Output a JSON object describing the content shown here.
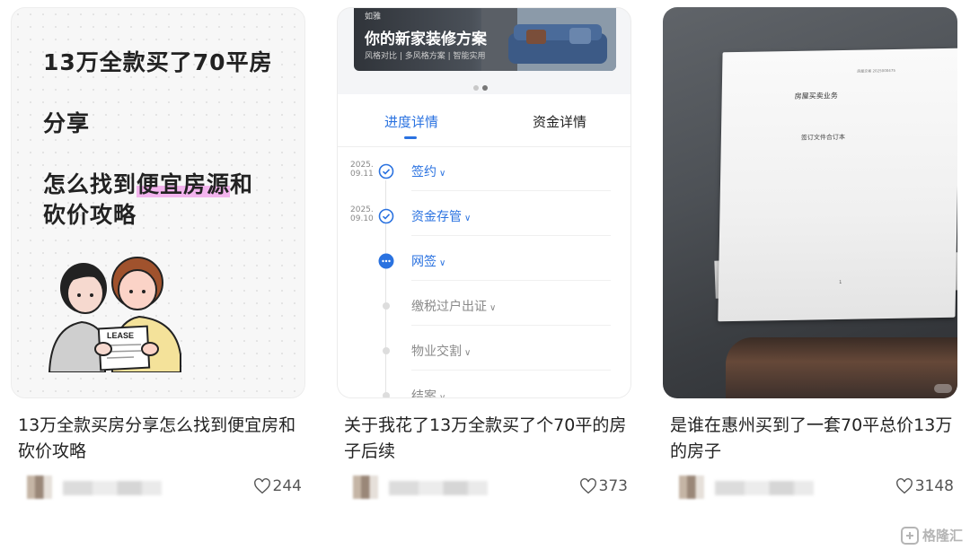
{
  "cards": [
    {
      "cover": {
        "line1": "13万全款买了70平房",
        "line2": "分享",
        "line3_pre": "怎么找到",
        "line3_hl": "便宜房源",
        "line3_post": "和",
        "line4": "砍价攻略",
        "illustration_label": "LEASE"
      },
      "title": "13万全款买房分享怎么找到便宜房和砍价攻略",
      "likes": "244"
    },
    {
      "cover": {
        "banner_tag": "如雅",
        "banner_title": "你的新家装修方案",
        "banner_sub": "风格对比 | 多风格方案 | 智能实用",
        "tabs": [
          "进度详情",
          "资金详情"
        ],
        "steps": [
          {
            "date_line1": "2025.",
            "date_line2": "09.11",
            "label": "签约",
            "status": "done"
          },
          {
            "date_line1": "2025.",
            "date_line2": "09.10",
            "label": "资金存管",
            "status": "done"
          },
          {
            "date_line1": "",
            "date_line2": "",
            "label": "网签",
            "status": "current"
          },
          {
            "date_line1": "",
            "date_line2": "",
            "label": "缴税过户出证",
            "status": "pending"
          },
          {
            "date_line1": "",
            "date_line2": "",
            "label": "物业交割",
            "status": "pending"
          },
          {
            "date_line1": "",
            "date_line2": "",
            "label": "结案",
            "status": "pending"
          }
        ]
      },
      "title": "关于我花了13万全款买了个70平的房子后续",
      "likes": "373"
    },
    {
      "cover": {
        "paper_head": "房屋交易  2025000475",
        "paper_title": "房屋买卖业务",
        "paper_sub": "签订文件合订本",
        "paper_page": "1"
      },
      "title": "是谁在惠州买到了一套70平总价13万的房子",
      "likes": "3148"
    }
  ],
  "brand": {
    "name": "格隆汇"
  },
  "colors": {
    "accent": "#2a72e0",
    "highlight": "#f3b4ee"
  }
}
